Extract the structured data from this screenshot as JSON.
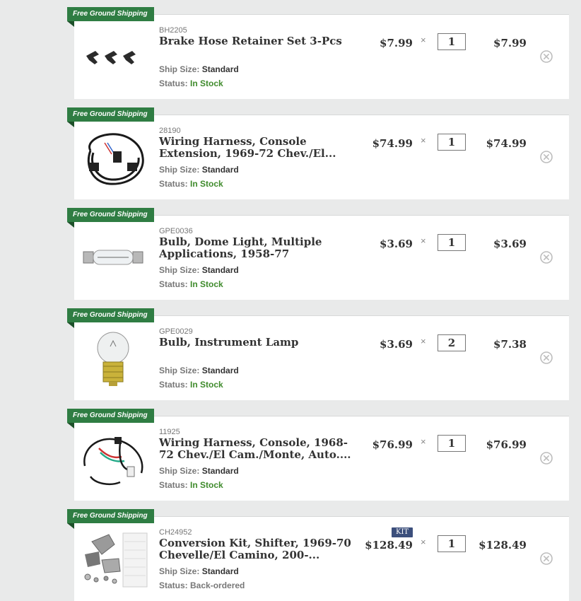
{
  "ship_label": "Ship Size:",
  "status_label": "Status:",
  "times_symbol": "×",
  "ribbon_text": "Free Ground Shipping",
  "colors": {
    "ribbon": "#2f7d43",
    "in_stock": "#3f8b2c",
    "kit_badge": "#3c4f7c"
  },
  "items": [
    {
      "sku": "BH2205",
      "title": "Brake Hose Retainer Set 3-Pcs",
      "price": "$7.99",
      "qty": "1",
      "total": "$7.99",
      "ship_size": "Standard",
      "status": "In Stock",
      "status_type": "instock",
      "image_icon": "brake-hose-retainer-image",
      "badge": ""
    },
    {
      "sku": "28190",
      "title": "Wiring Harness, Console Extension, 1969-72 Chev./El...",
      "price": "$74.99",
      "qty": "1",
      "total": "$74.99",
      "ship_size": "Standard",
      "status": "In Stock",
      "status_type": "instock",
      "image_icon": "wiring-harness-image",
      "badge": ""
    },
    {
      "sku": "GPE0036",
      "title": "Bulb, Dome Light, Multiple Applications, 1958-77",
      "price": "$3.69",
      "qty": "1",
      "total": "$3.69",
      "ship_size": "Standard",
      "status": "In Stock",
      "status_type": "instock",
      "image_icon": "dome-light-bulb-image",
      "badge": ""
    },
    {
      "sku": "GPE0029",
      "title": "Bulb, Instrument Lamp",
      "price": "$3.69",
      "qty": "2",
      "total": "$7.38",
      "ship_size": "Standard",
      "status": "In Stock",
      "status_type": "instock",
      "image_icon": "instrument-lamp-bulb-image",
      "badge": ""
    },
    {
      "sku": "11925",
      "title": "Wiring Harness, Console, 1968-72 Chev./El Cam./Monte, Auto....",
      "price": "$76.99",
      "qty": "1",
      "total": "$76.99",
      "ship_size": "Standard",
      "status": "In Stock",
      "status_type": "instock",
      "image_icon": "console-wiring-harness-image",
      "badge": ""
    },
    {
      "sku": "CH24952",
      "title": "Conversion Kit, Shifter, 1969-70 Chevelle/El Camino, 200-...",
      "price": "$128.49",
      "qty": "1",
      "total": "$128.49",
      "ship_size": "Standard",
      "status": "Back-ordered",
      "status_type": "back",
      "image_icon": "shifter-conversion-kit-image",
      "badge": "KIT"
    }
  ]
}
